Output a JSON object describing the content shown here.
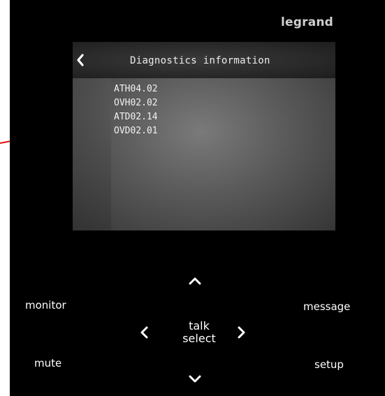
{
  "brand": {
    "name": "legrand"
  },
  "screen": {
    "back_icon": "chevron-left-icon",
    "title": "Diagnostics information",
    "items": [
      "ATH04.02",
      "OVH02.02",
      "ATD02.14",
      "OVD02.01"
    ]
  },
  "controls": {
    "monitor_label": "monitor",
    "mute_label": "mute",
    "message_label": "message",
    "setup_label": "setup",
    "talk_label": "talk",
    "select_label": "select",
    "up_icon": "chevron-up-icon",
    "down_icon": "chevron-down-icon",
    "left_icon": "chevron-left-icon",
    "right_icon": "chevron-right-icon"
  },
  "annotation": {
    "arrow_color": "#e01010"
  },
  "colors": {
    "panel": "#000000",
    "text": "#ffffff",
    "brand_text": "#cfcfcf"
  }
}
